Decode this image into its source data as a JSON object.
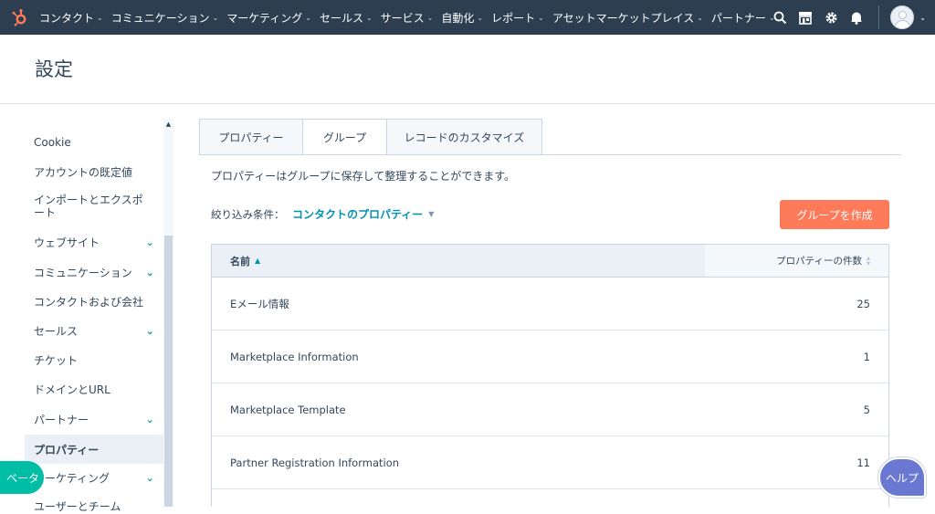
{
  "nav": {
    "logo_icon": "hubspot-sprocket-icon",
    "items": [
      {
        "label": "コンタクト"
      },
      {
        "label": "コミュニケーション"
      },
      {
        "label": "マーケティング"
      },
      {
        "label": "セールス"
      },
      {
        "label": "サービス"
      },
      {
        "label": "自動化"
      },
      {
        "label": "レポート"
      },
      {
        "label": "アセットマーケットプレイス"
      },
      {
        "label": "パートナー"
      }
    ],
    "icons": [
      "search-icon",
      "marketplace-icon",
      "gear-icon",
      "bell-icon"
    ],
    "accent": "#2d3e50"
  },
  "header": {
    "title": "設定"
  },
  "sidebar": {
    "items": [
      {
        "label": "Cookie",
        "expandable": false
      },
      {
        "label": "アカウントの既定値",
        "expandable": false
      },
      {
        "label": "インポートとエクスポート",
        "expandable": false
      },
      {
        "label": "ウェブサイト",
        "expandable": true
      },
      {
        "label": "コミュニケーション",
        "expandable": true
      },
      {
        "label": "コンタクトおよび会社",
        "expandable": false
      },
      {
        "label": "セールス",
        "expandable": true
      },
      {
        "label": "チケット",
        "expandable": false
      },
      {
        "label": "ドメインとURL",
        "expandable": false
      },
      {
        "label": "パートナー",
        "expandable": true
      },
      {
        "label": "プロパティー",
        "expandable": false,
        "active": true
      },
      {
        "label": "マーケティング",
        "expandable": true
      },
      {
        "label": "ユーザーとチーム",
        "expandable": false
      }
    ]
  },
  "main": {
    "tabs": [
      {
        "label": "プロパティー"
      },
      {
        "label": "グループ",
        "active": true
      },
      {
        "label": "レコードのカスタマイズ"
      }
    ],
    "description": "プロパティーはグループに保存して整理することができます。",
    "filter_label": "絞り込み条件：",
    "filter_value": "コンタクトのプロパティー",
    "create_button": "グループを作成",
    "create_button_color": "#ff7a59",
    "table": {
      "col_name": "名前",
      "col_count": "プロパティーの件数",
      "rows": [
        {
          "name": "Eメール情報",
          "count": "25"
        },
        {
          "name": "Marketplace Information",
          "count": "1"
        },
        {
          "name": "Marketplace Template",
          "count": "5"
        },
        {
          "name": "Partner Registration Information",
          "count": "11"
        }
      ]
    }
  },
  "beta_label": "ベータ",
  "help_label": "ヘルプ"
}
